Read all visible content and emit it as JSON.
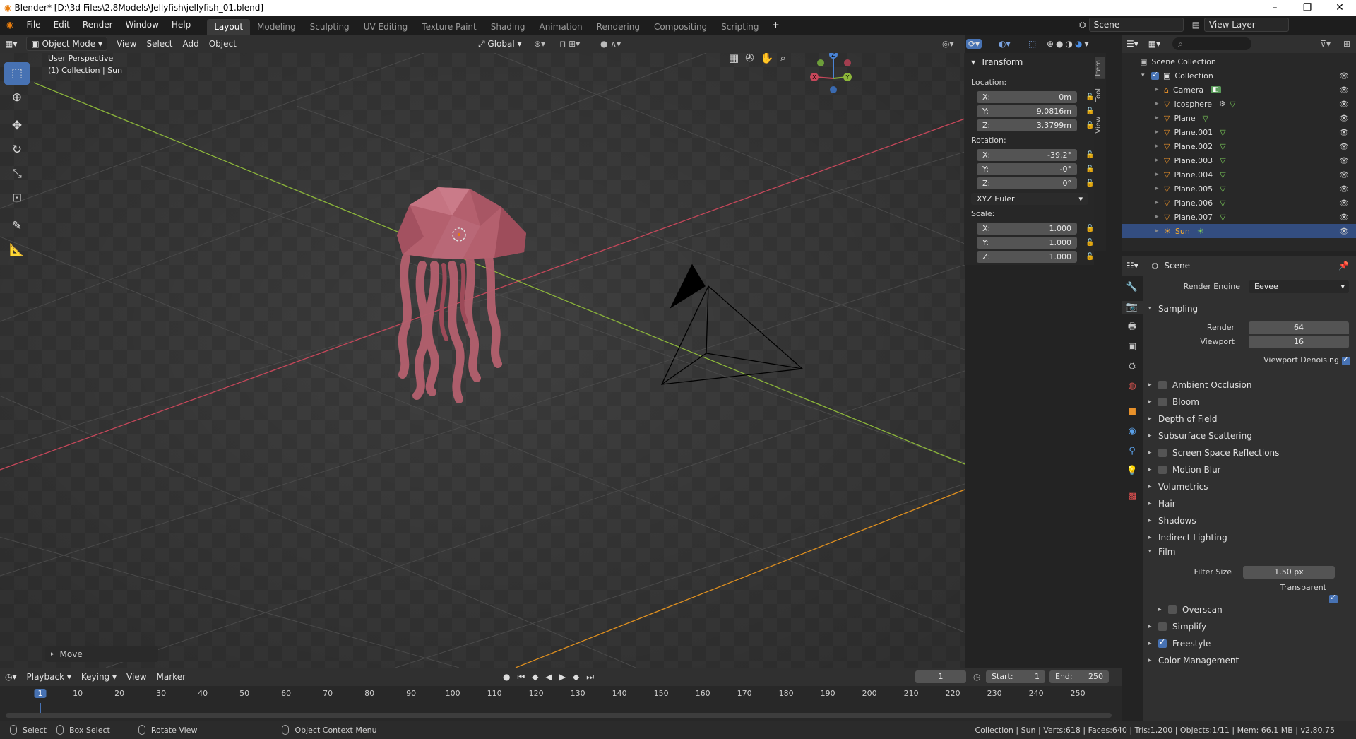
{
  "window": {
    "title": "Blender* [D:\\3d Files\\2.8Models\\Jellyfish\\jellyfish_01.blend]"
  },
  "menus": [
    "File",
    "Edit",
    "Render",
    "Window",
    "Help"
  ],
  "workspaces": [
    "Layout",
    "Modeling",
    "Sculpting",
    "UV Editing",
    "Texture Paint",
    "Shading",
    "Animation",
    "Rendering",
    "Compositing",
    "Scripting"
  ],
  "scene_selector": {
    "scene": "Scene",
    "view_layer": "View Layer"
  },
  "viewport_header": {
    "mode": "Object Mode",
    "menus": [
      "View",
      "Select",
      "Add",
      "Object"
    ],
    "orientation": "Global"
  },
  "viewport": {
    "perspective": "User Perspective",
    "context": "(1) Collection | Sun",
    "last_op": "Move"
  },
  "transform": {
    "title": "Transform",
    "location_label": "Location:",
    "location": {
      "x": "0m",
      "y": "9.0816m",
      "z": "3.3799m"
    },
    "rotation_label": "Rotation:",
    "rotation": {
      "x": "-39.2°",
      "y": "-0°",
      "z": "0°"
    },
    "rotation_mode": "XYZ Euler",
    "scale_label": "Scale:",
    "scale": {
      "x": "1.000",
      "y": "1.000",
      "z": "1.000"
    },
    "axis_labels": [
      "X:",
      "Y:",
      "Z:"
    ]
  },
  "npanel_tabs": [
    "Item",
    "Tool",
    "View"
  ],
  "outliner": {
    "root": "Scene Collection",
    "collection": "Collection",
    "objects": [
      "Camera",
      "Icosphere",
      "Plane",
      "Plane.001",
      "Plane.002",
      "Plane.003",
      "Plane.004",
      "Plane.005",
      "Plane.006",
      "Plane.007",
      "Sun"
    ],
    "selected": "Sun"
  },
  "properties": {
    "context": "Scene",
    "render_engine_label": "Render Engine",
    "render_engine": "Eevee",
    "sampling": {
      "title": "Sampling",
      "render_label": "Render",
      "render": "64",
      "viewport_label": "Viewport",
      "viewport": "16",
      "denoise_label": "Viewport Denoising"
    },
    "sections": [
      {
        "label": "Ambient Occlusion",
        "check": false
      },
      {
        "label": "Bloom",
        "check": false
      },
      {
        "label": "Depth of Field"
      },
      {
        "label": "Subsurface Scattering"
      },
      {
        "label": "Screen Space Reflections",
        "check": false
      },
      {
        "label": "Motion Blur",
        "check": false
      },
      {
        "label": "Volumetrics"
      },
      {
        "label": "Hair"
      },
      {
        "label": "Shadows"
      },
      {
        "label": "Indirect Lighting"
      }
    ],
    "film": {
      "title": "Film",
      "filter_label": "Filter Size",
      "filter": "1.50 px",
      "transparent_label": "Transparent",
      "overscan": "Overscan"
    },
    "tail": [
      {
        "label": "Simplify",
        "check": false
      },
      {
        "label": "Freestyle",
        "check": true
      },
      {
        "label": "Color Management"
      }
    ]
  },
  "timeline": {
    "menus": [
      "Playback",
      "Keying",
      "View",
      "Marker"
    ],
    "current_frame": "1",
    "start_label": "Start:",
    "start": "1",
    "end_label": "End:",
    "end": "250",
    "ticks": [
      "1",
      "10",
      "20",
      "30",
      "40",
      "50",
      "60",
      "70",
      "80",
      "90",
      "100",
      "110",
      "120",
      "130",
      "140",
      "150",
      "160",
      "170",
      "180",
      "190",
      "200",
      "210",
      "220",
      "230",
      "240",
      "250"
    ]
  },
  "statusbar": {
    "select": "Select",
    "box_select": "Box Select",
    "rotate": "Rotate View",
    "context_menu": "Object Context Menu",
    "stats": "Collection | Sun | Verts:618 | Faces:640 | Tris:1,200 | Objects:1/11 | Mem: 66.1 MB | v2.80.75"
  },
  "colors": {
    "accent": "#4772b3",
    "x_axis": "#c6475a",
    "y_axis": "#8cb63a",
    "z_axis": "#4a84d6",
    "jellyfish": "#b4606e",
    "selection": "#334d80"
  }
}
